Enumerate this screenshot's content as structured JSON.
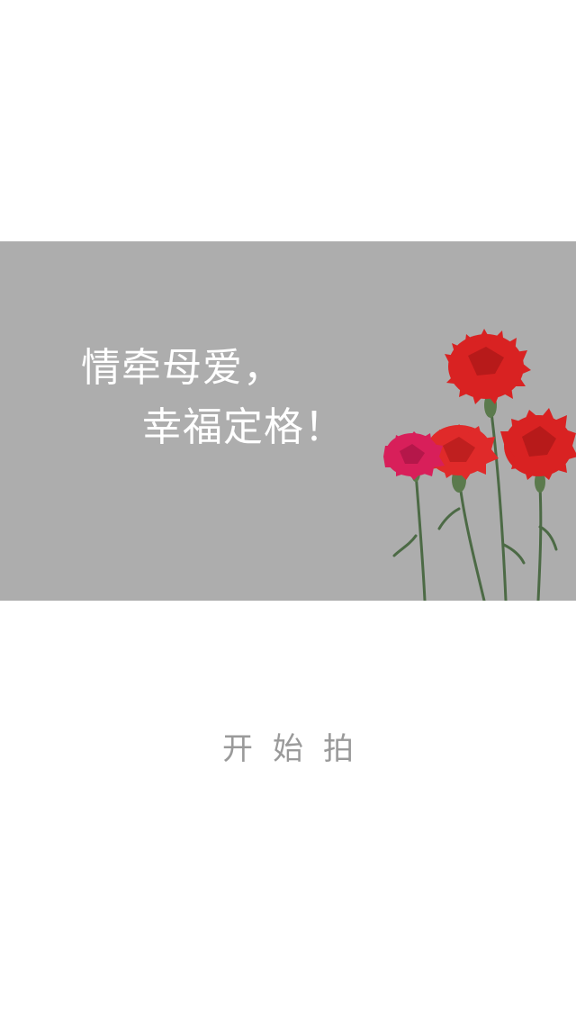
{
  "banner": {
    "background": "#adadad",
    "headline_line1": "情牵母爱，",
    "headline_line2": "幸福定格！",
    "image": "carnation-flowers"
  },
  "actions": {
    "start_label": "开始拍"
  },
  "colors": {
    "page_background": "#ffffff",
    "headline_text": "#ffffff",
    "start_text": "#9a9a9a",
    "carnation_red": "#d92222",
    "carnation_pink": "#d81f5a"
  }
}
